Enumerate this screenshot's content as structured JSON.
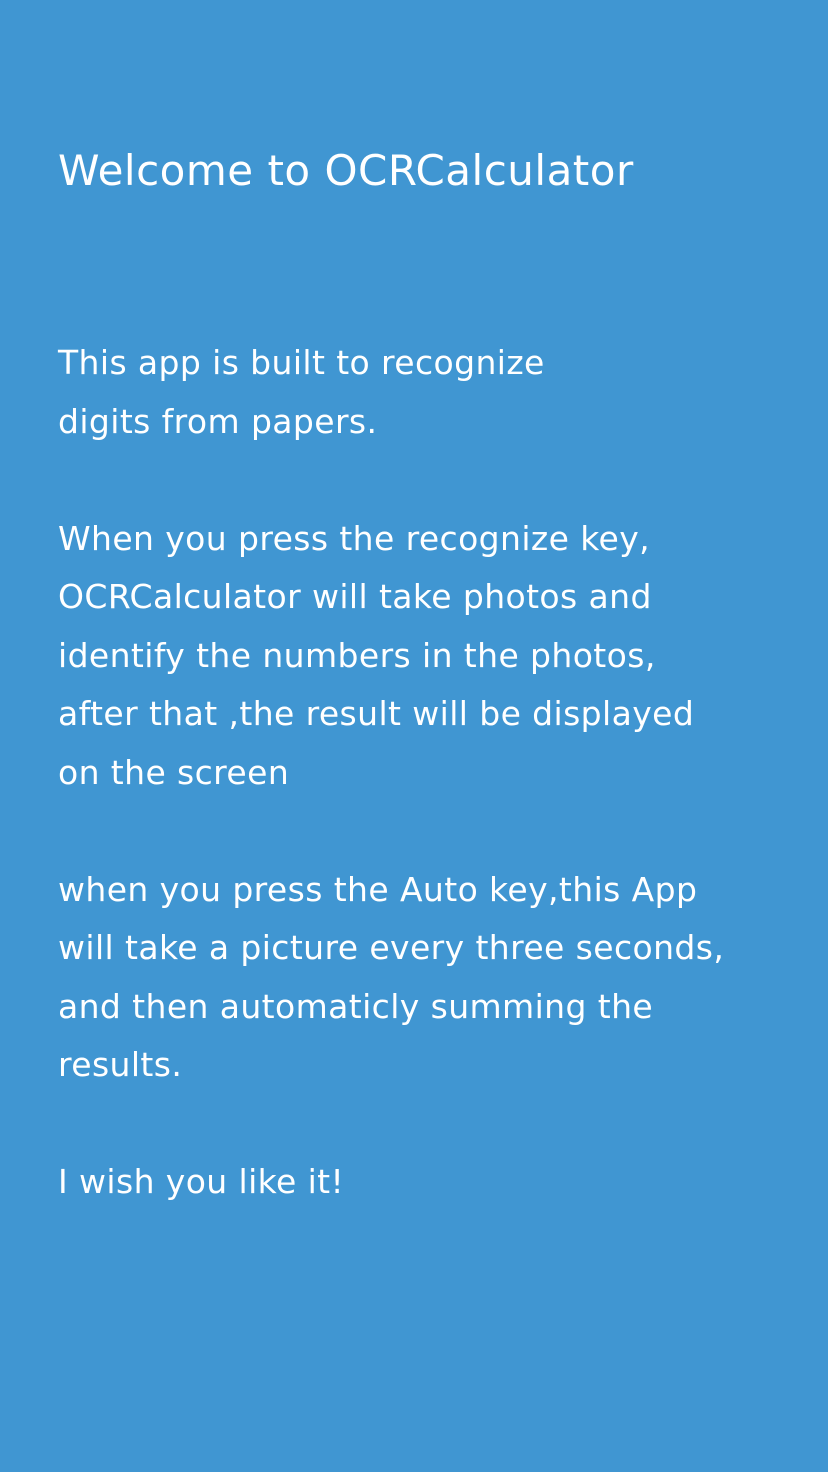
{
  "app": {
    "background_color": "#4096d2",
    "text_color": "#ffffff"
  },
  "welcome": {
    "title": "Welcome to OCRCalculator",
    "paragraphs": [
      {
        "lines": [
          "This app is built to recognize",
          "digits from papers."
        ]
      },
      {
        "lines": [
          "When you press the recognize key,",
          "OCRCalculator will take photos and",
          "identify the numbers in the photos,",
          "after that ,the result will be displayed",
          "on the screen"
        ]
      },
      {
        "lines": [
          "when you press the Auto key,this App",
          "will take a picture every three seconds,",
          "and then automaticly summing the",
          "results."
        ]
      },
      {
        "lines": [
          "I wish you like it!"
        ]
      }
    ]
  }
}
